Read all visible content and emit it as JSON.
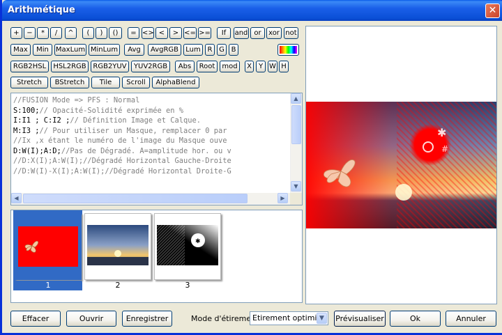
{
  "window": {
    "title": "Arithmétique",
    "close_label": "✕"
  },
  "toolbar": {
    "row1": [
      "+",
      "−",
      "*",
      "/",
      "^",
      "(",
      ")",
      "()",
      "=",
      "<>",
      "<",
      ">",
      "<=",
      ">=",
      "If",
      "and",
      "or",
      "xor",
      "not"
    ],
    "row2": [
      "Max",
      "Min",
      "MaxLum",
      "MinLum",
      "Avg",
      "AvgRGB",
      "Lum",
      "R",
      "G",
      "B"
    ],
    "row3": [
      "RGB2HSL",
      "HSL2RGB",
      "RGB2YUV",
      "YUV2RGB",
      "Abs",
      "Root",
      "mod",
      "X",
      "Y",
      "W",
      "H"
    ],
    "row4": [
      "Stretch",
      "BStretch",
      "Tile",
      "Scroll",
      "AlphaBlend"
    ]
  },
  "editor": {
    "lines": [
      [
        "",
        "//FUSION Mode => PFS : Normal"
      ],
      [
        "S:100;",
        "// Opacité-Solidité exprimée en %"
      ],
      [
        "I:I1 ; C:I2 ;",
        "// Définition Image et Calque."
      ],
      [
        "M:I3 ;",
        "// Pour utiliser un Masque, remplacer 0 par"
      ],
      [
        "",
        "//Ix ,x étant le numéro de l'image du Masque ouve"
      ],
      [
        "D:W(I);A:D;",
        "//Pas de Dégradé. A=amplitude hor. ou v"
      ],
      [
        "",
        "//D:X(I);A:W(I);//Dégradé Horizontal Gauche-Droite"
      ],
      [
        "",
        "//D:W(I)-X(I);A:W(I);//Dégradé Horizontal Droite-G"
      ]
    ]
  },
  "thumbnails": [
    {
      "label": "1",
      "selected": true
    },
    {
      "label": "2",
      "selected": false
    },
    {
      "label": "3",
      "selected": false
    }
  ],
  "footer": {
    "clear_label": "Effacer",
    "open_label": "Ouvrir",
    "save_label": "Enregistrer",
    "stretch_mode_label": "Mode d'étirement",
    "stretch_mode_value": "Etirement optimisé",
    "preview_label": "Prévisualiser",
    "ok_label": "Ok",
    "cancel_label": "Annuler"
  },
  "colors": {
    "titlebar": "#0a4fd6",
    "selection": "#316ac5",
    "accent_red": "#ff0000"
  }
}
